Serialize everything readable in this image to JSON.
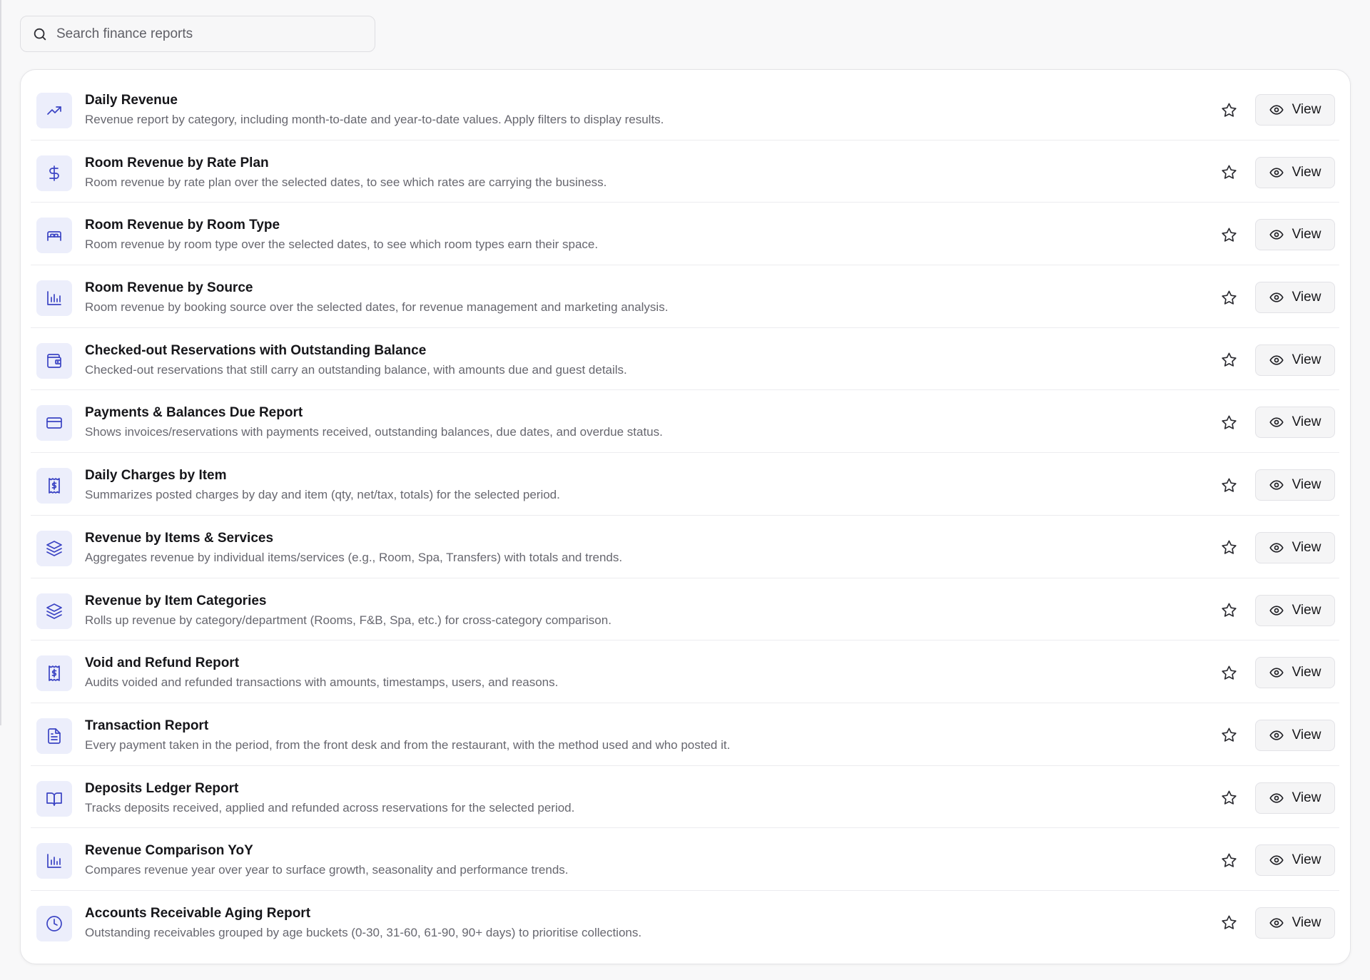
{
  "search": {
    "placeholder": "Search finance reports",
    "value": "",
    "icon": "search-icon"
  },
  "colors": {
    "icon_accent": "#3b44c4",
    "icon_tile_bg": "#eceefb",
    "page_bg": "#f8f8f9"
  },
  "reports": [
    {
      "title": "Daily Revenue",
      "description": "Revenue report by category, including month-to-date and year-to-date values. Apply filters to display results.",
      "icon": "trending-up-icon",
      "favorite_icon": "star-icon",
      "action_label": "View"
    },
    {
      "title": "Room Revenue by Rate Plan",
      "description": "Room revenue by rate plan over the selected dates, to see which rates are carrying the business.",
      "icon": "dollar-sign-icon",
      "favorite_icon": "star-icon",
      "action_label": "View"
    },
    {
      "title": "Room Revenue by Room Type",
      "description": "Room revenue by room type over the selected dates, to see which room types earn their space.",
      "icon": "bed-icon",
      "favorite_icon": "star-icon",
      "action_label": "View"
    },
    {
      "title": "Room Revenue by Source",
      "description": "Room revenue by booking source over the selected dates, for revenue management and marketing analysis.",
      "icon": "bar-chart-icon",
      "favorite_icon": "star-icon",
      "action_label": "View"
    },
    {
      "title": "Checked-out Reservations with Outstanding Balance",
      "description": "Checked-out reservations that still carry an outstanding balance, with amounts due and guest details.",
      "icon": "wallet-icon",
      "favorite_icon": "star-icon",
      "action_label": "View"
    },
    {
      "title": "Payments & Balances Due Report",
      "description": "Shows invoices/reservations with payments received, outstanding balances, due dates, and overdue status.",
      "icon": "credit-card-icon",
      "favorite_icon": "star-icon",
      "action_label": "View"
    },
    {
      "title": "Daily Charges by Item",
      "description": "Summarizes posted charges by day and item (qty, net/tax, totals) for the selected period.",
      "icon": "receipt-icon",
      "favorite_icon": "star-icon",
      "action_label": "View"
    },
    {
      "title": "Revenue by Items & Services",
      "description": "Aggregates revenue by individual items/services (e.g., Room, Spa, Transfers) with totals and trends.",
      "icon": "layers-icon",
      "favorite_icon": "star-icon",
      "action_label": "View"
    },
    {
      "title": "Revenue by Item Categories",
      "description": "Rolls up revenue by category/department (Rooms, F&B, Spa, etc.) for cross-category comparison.",
      "icon": "layers-icon",
      "favorite_icon": "star-icon",
      "action_label": "View"
    },
    {
      "title": "Void and Refund Report",
      "description": "Audits voided and refunded transactions with amounts, timestamps, users, and reasons.",
      "icon": "receipt-icon",
      "favorite_icon": "star-icon",
      "action_label": "View"
    },
    {
      "title": "Transaction Report",
      "description": "Every payment taken in the period, from the front desk and from the restaurant, with the method used and who posted it.",
      "icon": "file-text-icon",
      "favorite_icon": "star-icon",
      "action_label": "View"
    },
    {
      "title": "Deposits Ledger Report",
      "description": "Tracks deposits received, applied and refunded across reservations for the selected period.",
      "icon": "book-open-icon",
      "favorite_icon": "star-icon",
      "action_label": "View"
    },
    {
      "title": "Revenue Comparison YoY",
      "description": "Compares revenue year over year to surface growth, seasonality and performance trends.",
      "icon": "bar-chart-icon",
      "favorite_icon": "star-icon",
      "action_label": "View"
    },
    {
      "title": "Accounts Receivable Aging Report",
      "description": "Outstanding receivables grouped by age buckets (0-30, 31-60, 61-90, 90+ days) to prioritise collections.",
      "icon": "clock-icon",
      "favorite_icon": "star-icon",
      "action_label": "View"
    }
  ]
}
